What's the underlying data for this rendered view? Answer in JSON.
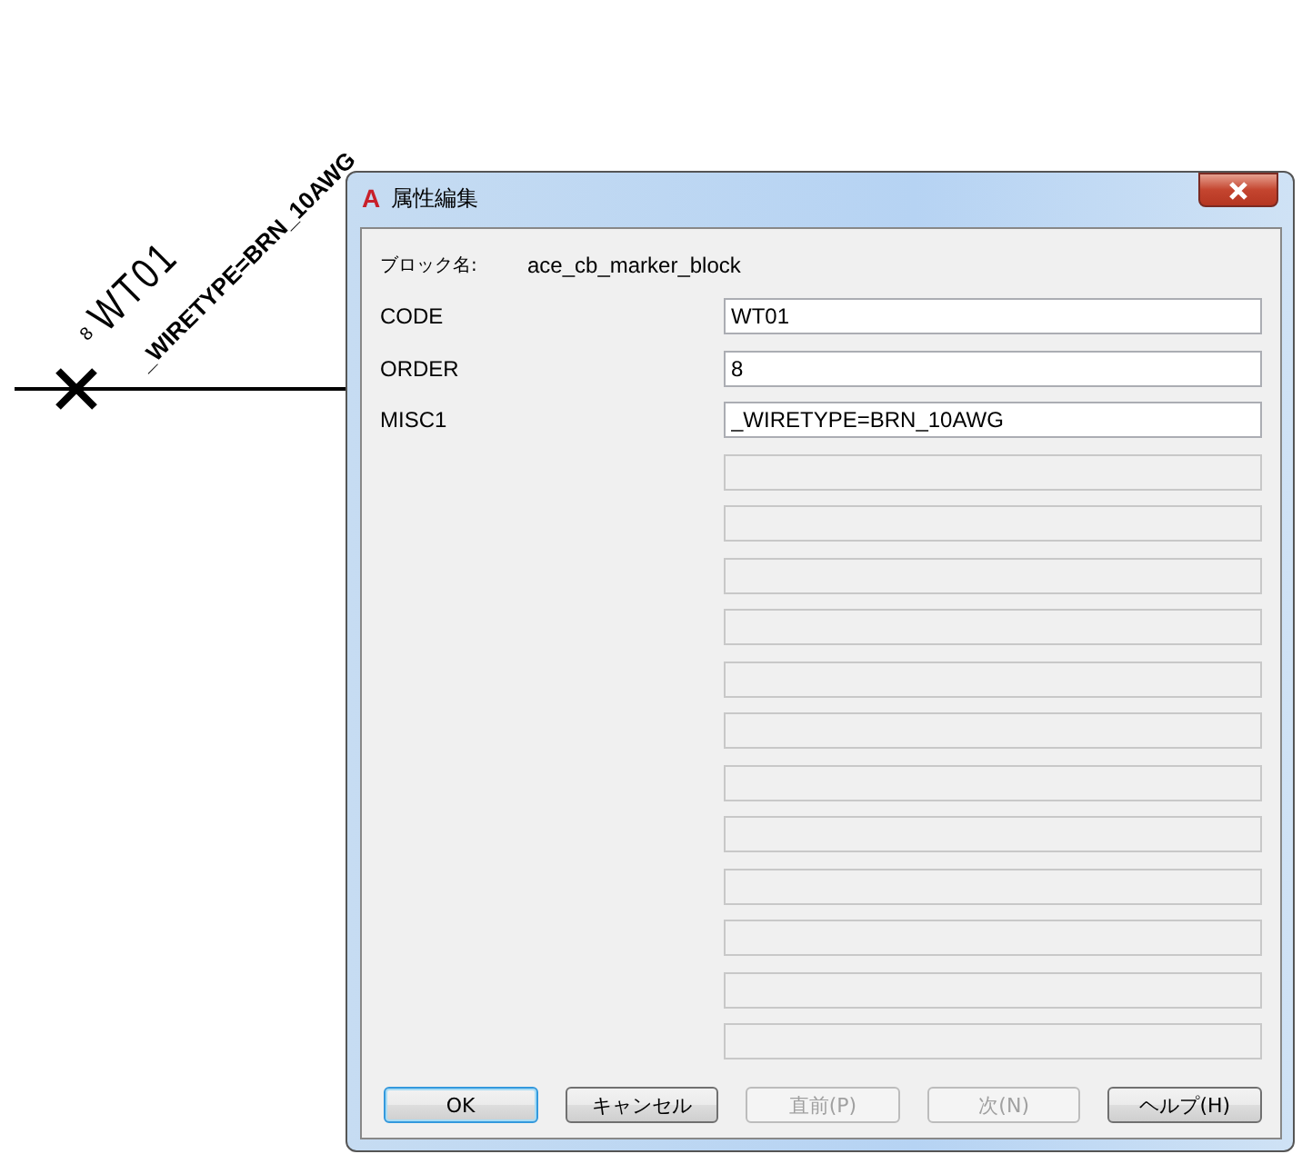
{
  "drawing": {
    "labels": [
      {
        "kind": "index",
        "text": "8"
      },
      {
        "kind": "code",
        "text": "WT01"
      },
      {
        "kind": "misc",
        "text": "_WIRETYPE=BRN_10AWG"
      }
    ]
  },
  "window": {
    "icon_text": "A",
    "title": "属性編集"
  },
  "block": {
    "label": "ブロック名:",
    "value": "ace_cb_marker_block"
  },
  "fields": [
    {
      "label": "CODE",
      "value": "WT01",
      "disabled": false
    },
    {
      "label": "ORDER",
      "value": "8",
      "disabled": false
    },
    {
      "label": "MISC1",
      "value": "_WIRETYPE=BRN_10AWG",
      "disabled": false
    },
    {
      "disabled": true
    },
    {
      "disabled": true
    },
    {
      "disabled": true
    },
    {
      "disabled": true
    },
    {
      "disabled": true
    },
    {
      "disabled": true
    },
    {
      "disabled": true
    },
    {
      "disabled": true
    },
    {
      "disabled": true
    },
    {
      "disabled": true
    },
    {
      "disabled": true
    },
    {
      "disabled": true
    }
  ],
  "buttons": [
    {
      "label": "OK",
      "default": true,
      "disabled": false
    },
    {
      "label": "キャンセル",
      "default": false,
      "disabled": false
    },
    {
      "label": "直前(P)",
      "default": false,
      "disabled": true
    },
    {
      "label": "次(N)",
      "default": false,
      "disabled": true
    },
    {
      "label": "ヘルプ(H)",
      "default": false,
      "disabled": false
    }
  ]
}
